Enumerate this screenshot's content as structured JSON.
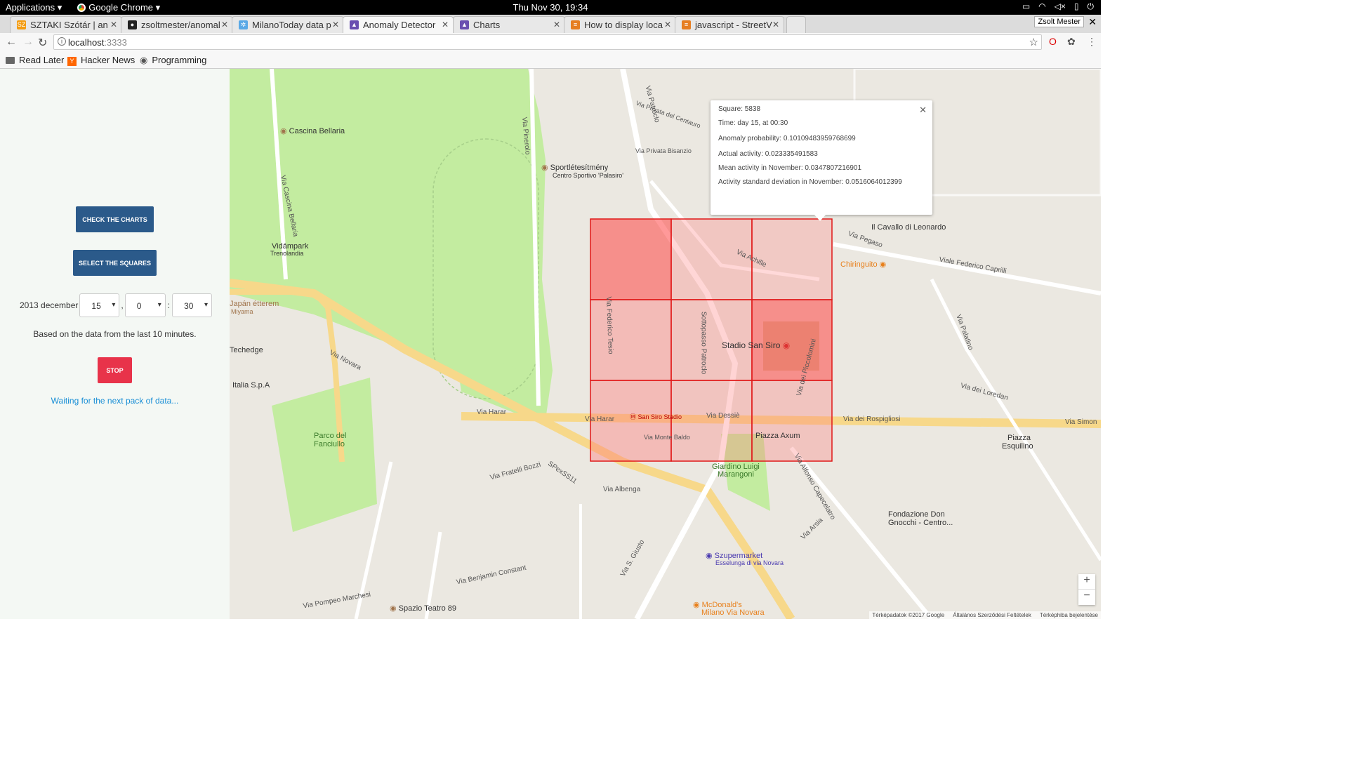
{
  "os": {
    "applications": "Applications",
    "browser": "Google Chrome",
    "clock": "Thu Nov 30, 19:34"
  },
  "tabs": [
    {
      "label": "SZTAKI Szótár | an",
      "favicon_color": "#f39c12",
      "favicon_text": "SZ"
    },
    {
      "label": "zsoltmester/anomal",
      "favicon_color": "#222222",
      "favicon_text": "●"
    },
    {
      "label": "MilanoToday data p",
      "favicon_color": "#5aa9e6",
      "favicon_text": "✲"
    },
    {
      "label": "Anomaly Detector",
      "favicon_color": "#6a4fb0",
      "favicon_text": "▲"
    },
    {
      "label": "Charts",
      "favicon_color": "#6a4fb0",
      "favicon_text": "▲"
    },
    {
      "label": "How to display loca",
      "favicon_color": "#e67e22",
      "favicon_text": "≡"
    },
    {
      "label": "javascript - StreetV",
      "favicon_color": "#e67e22",
      "favicon_text": "≡"
    }
  ],
  "profile_name": "Zsolt Mester",
  "url": {
    "host": "localhost",
    "port": ":3333"
  },
  "bookmarks": {
    "read_later": "Read Later",
    "hacker_news": "Hacker News",
    "programming": "Programming"
  },
  "panel": {
    "check_charts": "CHECK THE CHARTS",
    "select_squares": "SELECT THE SQUARES",
    "date_label": "2013 december",
    "day": "15",
    "hour": "0",
    "minute": "30",
    "basis_text": "Based on the data from the last 10 minutes.",
    "stop": "STOP",
    "waiting": "Waiting for the next pack of data..."
  },
  "popup": {
    "square": "Square: 5838",
    "time": "Time: day 15, at 00:30",
    "anomaly": "Anomaly probability: 0.10109483959768699",
    "actual": "Actual activity: 0.023335491583",
    "mean": "Mean activity in November: 0.0347807216901",
    "stddev": "Activity standard deviation in November: 0.0516064012399"
  },
  "map_labels": {
    "cascina_bellaria": "Cascina Bellaria",
    "sportletesitmeny": "Sportlétesítmény",
    "centro_sportivo": "Centro Sportivo 'Palasiro'",
    "vidampark": "Vidámpark",
    "trenolandia": "Trenolandia",
    "japan": "Japán étterem",
    "miyama": "Miyama",
    "techedge": "Techedge",
    "italia_spa": "Italia S.p.A",
    "parco": "Parco del",
    "fanciullo": "Fanciullo",
    "stadio": "Stadio San Siro",
    "cavallo": "Il Cavallo di Leonardo",
    "chiringuito": "Chiringuito",
    "san_siro_stadio": "San Siro Stadio",
    "piazza_axum": "Piazza Axum",
    "giardino": "Giardino Luigi",
    "marangoni": "Marangoni",
    "piazza_esquilino": "Piazza",
    "esquilino": "Esquilino",
    "fondazione": "Fondazione Don",
    "gnocchi": "Gnocchi - Centro...",
    "szupermarket": "Szupermarket",
    "esselunga": "Esselunga di via Novara",
    "spazio": "Spazio Teatro 89",
    "mcdonalds": "McDonald's",
    "milano_novara": "Milano Via Novara",
    "via_harar_1": "Via Harar",
    "via_harar_2": "Via Harar",
    "via_dessie": "Via Dessiè",
    "via_rospigliosi": "Via dei Rospigliosi",
    "via_simon": "Via Simon",
    "via_novara": "Via Novara",
    "spexss11": "SPexSS11",
    "via_monte_baldo": "Via Monte Baldo",
    "via_achille": "Via Achille",
    "via_pegaso": "Via Pegaso",
    "via_caprilli": "Viale Federico Caprilli",
    "via_ippodromo": "Via Ippodromo",
    "via_patroclo": "Via Patroclo",
    "via_pinerolo": "Via Pinerolo",
    "via_tesio": "Via Federico Tesio",
    "sottopasso": "Sottopasso Patroclo",
    "via_piccolomini": "Via dei Piccolomini",
    "via_fratelli_bozzi": "Via Fratelli Bozzi",
    "via_albenga": "Via Albenga",
    "via_benjamin": "Via Benjamin Constant",
    "via_pompeo": "Via Pompeo Marchesi",
    "via_sgiusto": "Via S. Giusto",
    "via_caprecelatro": "Via Alfonso Capecelatro",
    "via_privata_bisanzio": "Via Privata Bisanzio",
    "via_privata_centauro": "Via Privata del Centauro",
    "via_cascina_bellaria": "Via Cascina Bellaria",
    "via_arsia": "Via Arsia",
    "via_palatino": "Via Palatino",
    "via_loredan": "Via dei Loredan"
  },
  "attribution": {
    "data": "Térképadatok ©2017 Google",
    "terms": "Általános Szerződési Feltételek",
    "report": "Térképhiba bejelentése"
  },
  "colors": {
    "primary_button": "#2b5a8a",
    "stop_button": "#e8334a",
    "waiting_text": "#1a8fd6",
    "heat_high": "rgba(255,80,80,0.55)",
    "heat_low": "rgba(255,120,120,0.32)",
    "grid_stroke": "#e01818"
  }
}
